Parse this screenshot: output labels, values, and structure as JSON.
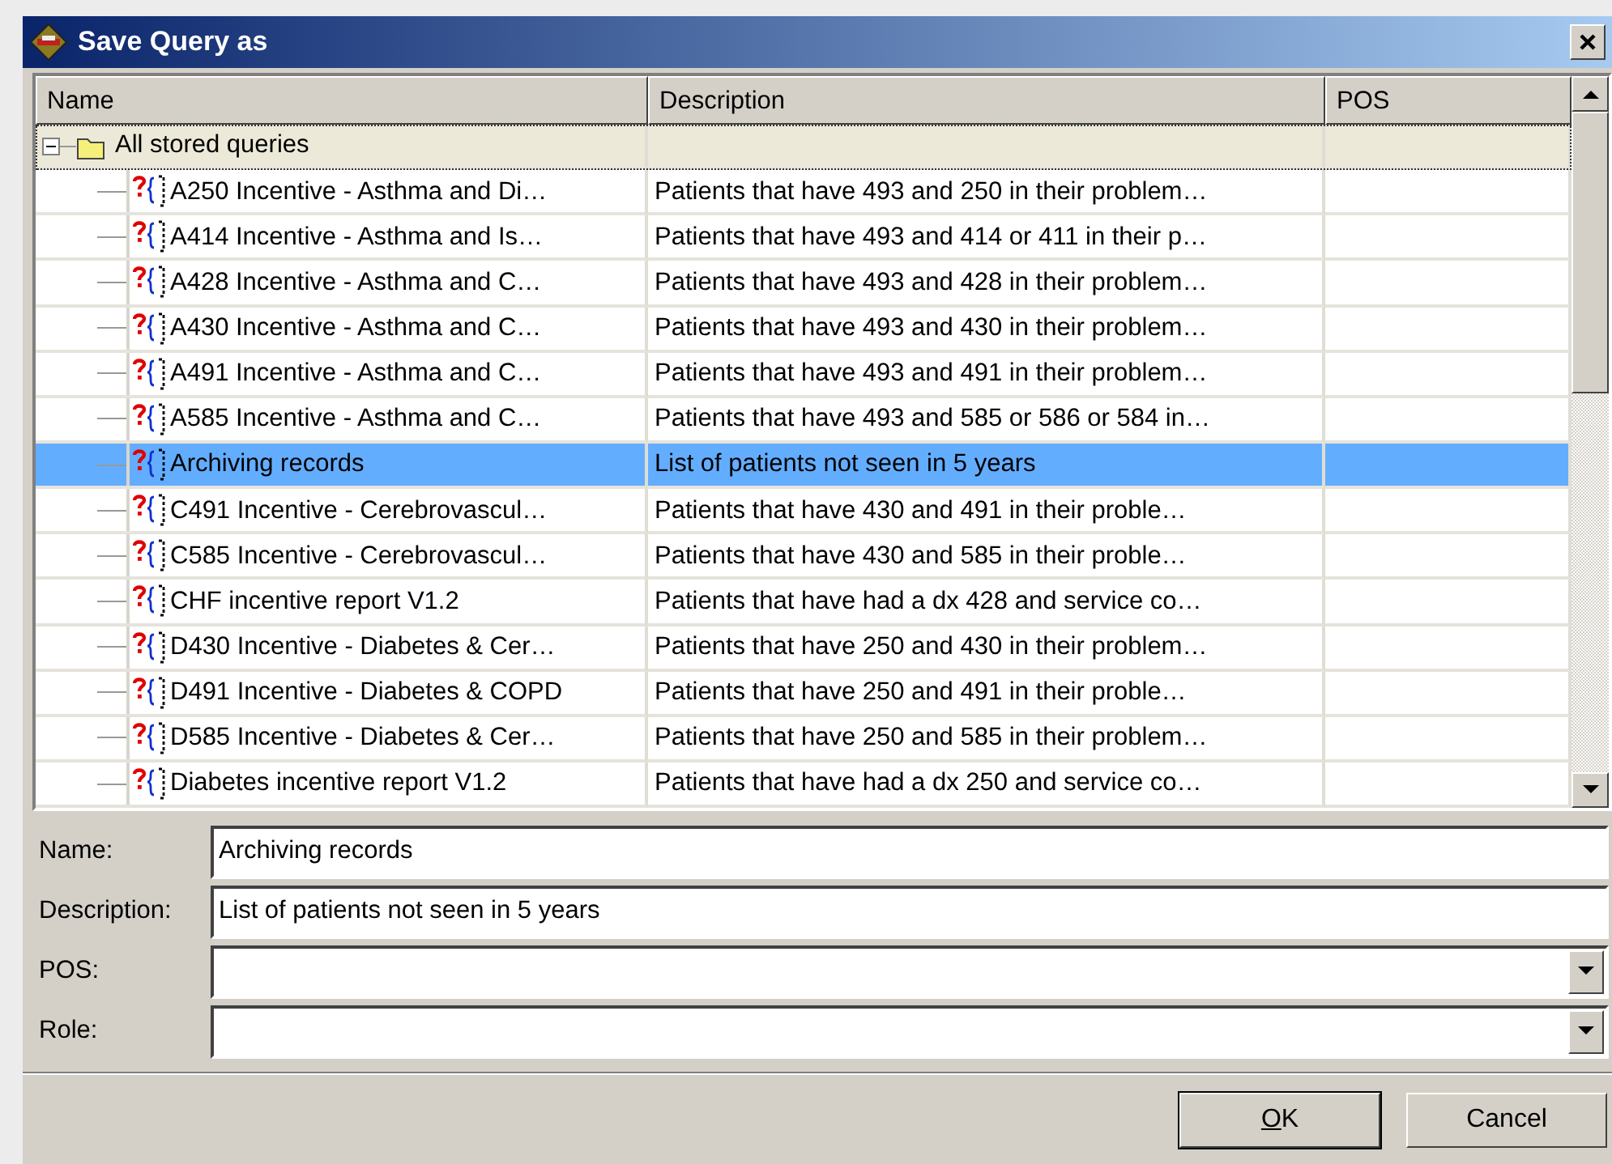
{
  "window": {
    "title": "Save Query as"
  },
  "table": {
    "columns": [
      "Name",
      "Description",
      "POS"
    ],
    "root": {
      "name": "All stored queries",
      "expanded": true,
      "children": [
        {
          "name": "A250 Incentive - Asthma and Di…",
          "description": "Patients that have 493 and 250 in their problem…",
          "selected": false
        },
        {
          "name": "A414 Incentive - Asthma and Is…",
          "description": "Patients that have 493 and 414 or 411 in their p…",
          "selected": false
        },
        {
          "name": "A428 Incentive - Asthma and C…",
          "description": "Patients that have 493 and 428 in their problem…",
          "selected": false
        },
        {
          "name": "A430 Incentive - Asthma and C…",
          "description": "Patients that have 493 and 430 in their problem…",
          "selected": false
        },
        {
          "name": "A491 Incentive - Asthma and C…",
          "description": "Patients that have 493 and 491 in their problem…",
          "selected": false
        },
        {
          "name": "A585 Incentive - Asthma and C…",
          "description": "Patients that have 493 and 585 or 586 or 584 in…",
          "selected": false
        },
        {
          "name": "Archiving records",
          "description": "List of patients not seen in 5 years",
          "selected": true
        },
        {
          "name": "C491 Incentive - Cerebrovascul…",
          "description": "Patients that have 430 and 491  in their proble…",
          "selected": false
        },
        {
          "name": "C585 Incentive - Cerebrovascul…",
          "description": "Patients that have 430 and 585  in their proble…",
          "selected": false
        },
        {
          "name": "CHF incentive report V1.2",
          "description": "Patients that have had a dx 428 and service co…",
          "selected": false
        },
        {
          "name": "D430 Incentive - Diabetes & Cer…",
          "description": "Patients that have 250 and 430 in their problem…",
          "selected": false
        },
        {
          "name": "D491 Incentive - Diabetes & COPD",
          "description": "Patients that have 250 and 491  in their proble…",
          "selected": false
        },
        {
          "name": "D585 Incentive - Diabetes & Cer…",
          "description": "Patients that have 250 and 585 in their problem…",
          "selected": false
        },
        {
          "name": "Diabetes incentive report V1.2",
          "description": "Patients that have had a dx 250 and service co…",
          "selected": false
        }
      ]
    }
  },
  "form": {
    "fields": [
      {
        "label": "Name:",
        "kind": "text",
        "value": "Archiving records"
      },
      {
        "label": "Description:",
        "kind": "text",
        "value": "List of patients not seen in 5 years"
      },
      {
        "label": "POS:",
        "kind": "dropdown"
      },
      {
        "label": "Role:",
        "kind": "dropdown"
      }
    ]
  },
  "buttons": [
    {
      "label": "OK",
      "default": true,
      "underline_first": true
    },
    {
      "label": "Cancel",
      "default": false,
      "underline_first": false
    }
  ]
}
